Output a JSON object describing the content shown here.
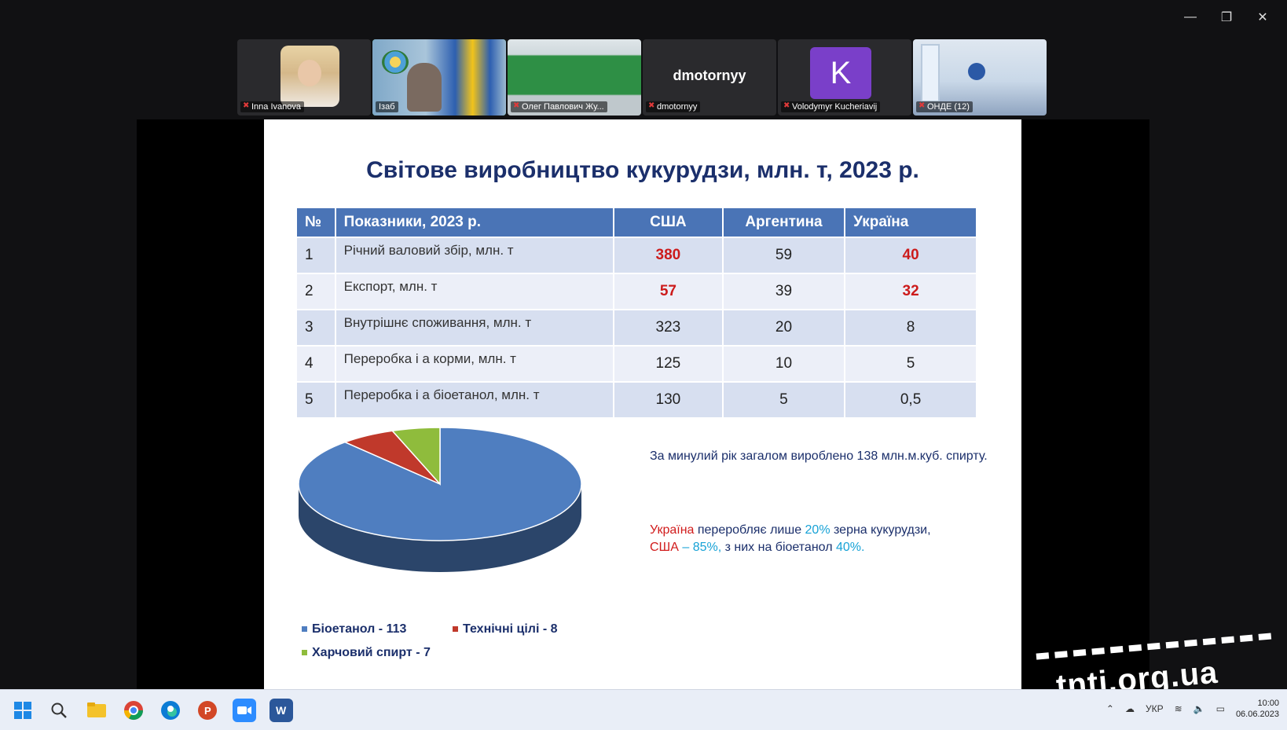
{
  "window_controls": {
    "minimize": "—",
    "restore": "❐",
    "close": "✕"
  },
  "participants": [
    {
      "name": "Inna Ivanova",
      "display": ""
    },
    {
      "name": "Ізаб",
      "display": ""
    },
    {
      "name": "Олег Павлович Жу...",
      "display": ""
    },
    {
      "name": "dmotornyy",
      "display": "dmotornyy"
    },
    {
      "name": "Volodymyr Kucheriavij",
      "display": "",
      "initial": "K"
    },
    {
      "name": "ОНДЕ (12)",
      "display": ""
    }
  ],
  "slide": {
    "title": "Світове виробництво кукурудзи, млн. т, 2023 р.",
    "table": {
      "headers": [
        "№",
        "Показники, 2023 р.",
        "США",
        "Аргентина",
        "Україна"
      ],
      "rows": [
        [
          "1",
          "Річний валовий збір, млн. т",
          "380",
          "59",
          "40"
        ],
        [
          "2",
          "Експорт, млн. т",
          "57",
          "39",
          "32"
        ],
        [
          "3",
          "Внутрішнє споживання, млн. т",
          "323",
          "20",
          "8"
        ],
        [
          "4",
          "Переробка і а корми, млн. т",
          "125",
          "10",
          "5"
        ],
        [
          "5",
          "Переробка і а біоетанол, млн. т",
          "130",
          "5",
          "0,5"
        ]
      ]
    },
    "note1": "За минулий рік загалом вироблено 138 млн.м.куб. спирту.",
    "note2": {
      "part1": "Україна",
      "part2": " переробляє лише ",
      "part3": "20%",
      "part4": " зерна кукурудзи,",
      "part5": "США",
      "part6": " – ",
      "part7": "85%,",
      "part8": " з них на біоетанол ",
      "part9": "40%."
    },
    "legend": [
      {
        "label": "Біоетанол - 113",
        "color": "#4f7ec0"
      },
      {
        "label": "Технічні цілі - 8",
        "color": "#c0392b"
      },
      {
        "label": "Харчовий спирт - 7",
        "color": "#8fbc3c"
      }
    ]
  },
  "chart_data": {
    "type": "pie",
    "categories": [
      "Біоетанол",
      "Технічні цілі",
      "Харчовий спирт"
    ],
    "values": [
      113,
      8,
      7
    ],
    "colors": [
      "#4f7ec0",
      "#c0392b",
      "#8fbc3c"
    ],
    "legend_position": "bottom-left"
  },
  "watermark": "tnti.org.ua",
  "taskbar": {
    "icons": [
      "windows-start-icon",
      "search-icon",
      "file-explorer-icon",
      "chrome-icon",
      "edge-icon",
      "powerpoint-icon",
      "zoom-icon",
      "word-icon"
    ],
    "tray": {
      "lang": "УКР",
      "time": "10:00",
      "date": "06.06.2023"
    }
  }
}
